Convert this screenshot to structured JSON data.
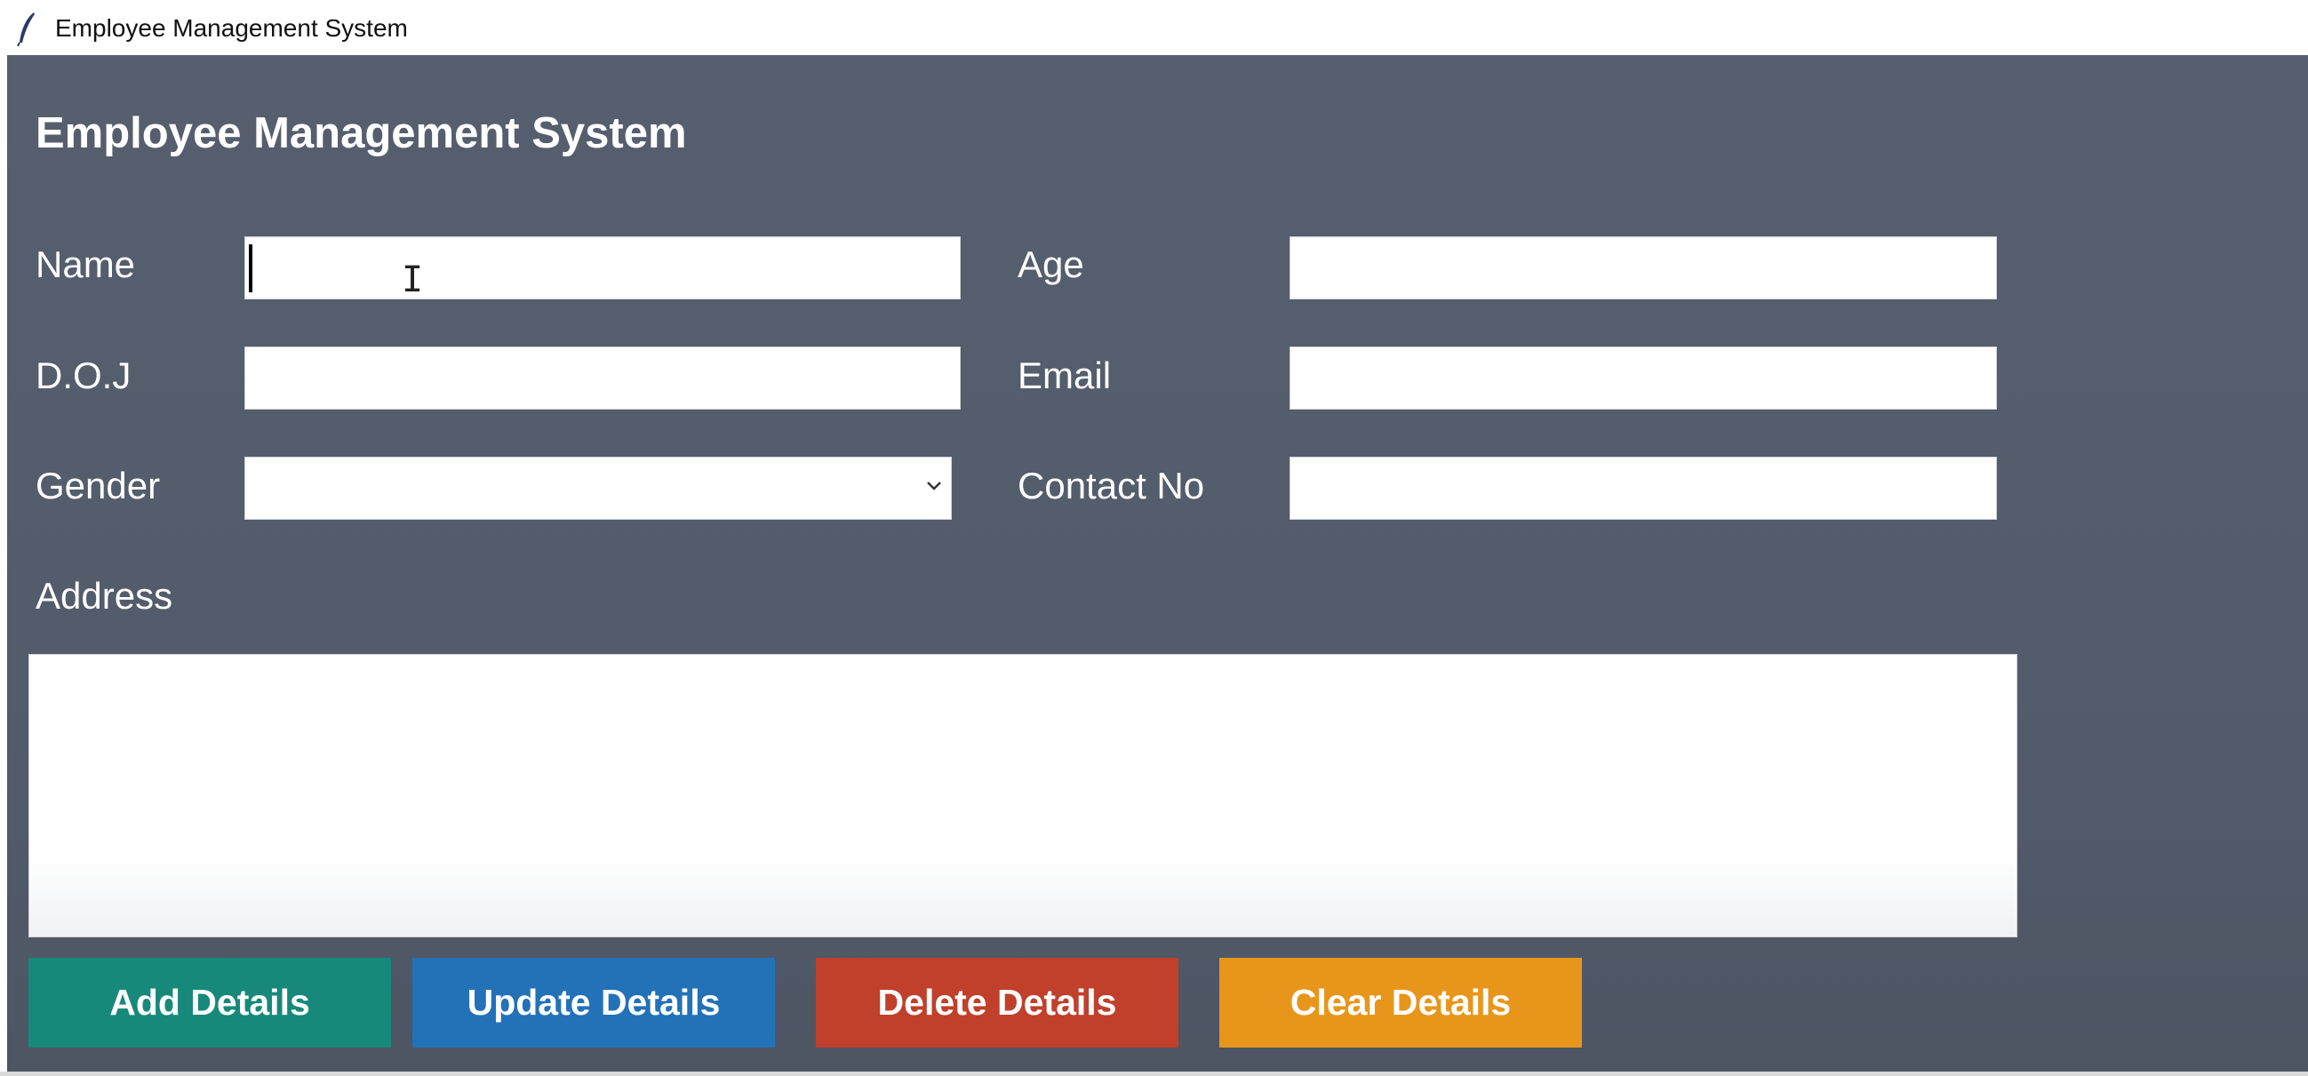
{
  "window": {
    "title": "Employee Management System"
  },
  "app": {
    "heading": "Employee Management System"
  },
  "form": {
    "name_label": "Name",
    "name_value": "",
    "age_label": "Age",
    "age_value": "",
    "doj_label": "D.O.J",
    "doj_value": "",
    "email_label": "Email",
    "email_value": "",
    "gender_label": "Gender",
    "gender_value": "",
    "contact_label": "Contact No",
    "contact_value": "",
    "address_label": "Address",
    "address_value": ""
  },
  "buttons": {
    "add": "Add Details",
    "update": "Update Details",
    "delete": "Delete Details",
    "clear": "Clear Details"
  },
  "colors": {
    "background": "#555e6d",
    "add": "#16897a",
    "update": "#2372b8",
    "delete": "#c0402c",
    "clear": "#e8961b"
  },
  "icons": {
    "window_icon": "feather-icon",
    "dropdown": "chevron-down-icon"
  }
}
